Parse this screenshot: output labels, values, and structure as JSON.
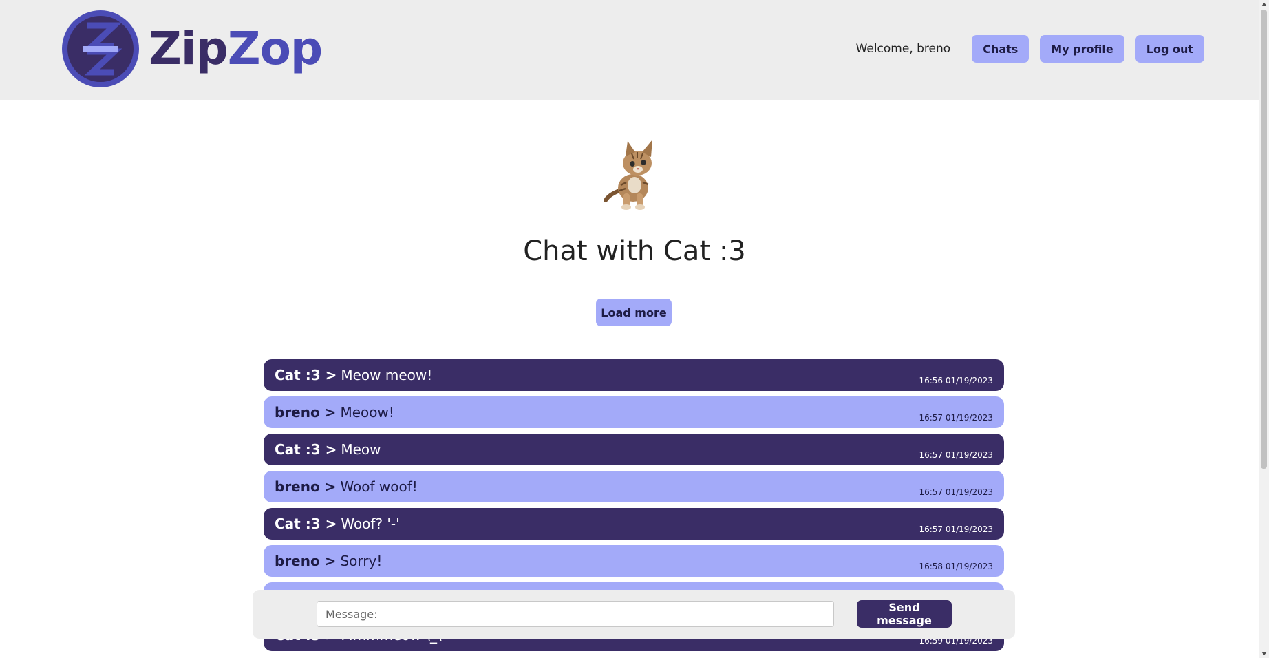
{
  "brand": {
    "part1": "Zip",
    "part2": "Zop"
  },
  "header": {
    "welcome": "Welcome, breno",
    "nav": {
      "chats": "Chats",
      "profile": "My profile",
      "logout": "Log out"
    }
  },
  "chat": {
    "title": "Chat with Cat :3",
    "load_more": "Load more",
    "messages": [
      {
        "author": "Cat :3 >",
        "text": "Meow meow!",
        "time": "16:56 01/19/2023",
        "kind": "other"
      },
      {
        "author": "breno >",
        "text": "Meoow!",
        "time": "16:57 01/19/2023",
        "kind": "mine"
      },
      {
        "author": "Cat :3 >",
        "text": "Meow",
        "time": "16:57 01/19/2023",
        "kind": "other"
      },
      {
        "author": "breno >",
        "text": "Woof woof!",
        "time": "16:57 01/19/2023",
        "kind": "mine"
      },
      {
        "author": "Cat :3 >",
        "text": "Woof? '-'",
        "time": "16:57 01/19/2023",
        "kind": "other"
      },
      {
        "author": "breno >",
        "text": "Sorry!",
        "time": "16:58 01/19/2023",
        "kind": "mine"
      },
      {
        "author": "",
        "text": "",
        "time": "",
        "kind": "mine"
      },
      {
        "author": "Cat :3 >",
        "text": "Mmmmeow \\_\\",
        "time": "16:59 01/19/2023",
        "kind": "other"
      }
    ]
  },
  "compose": {
    "placeholder": "Message:",
    "send": "Send message"
  },
  "colors": {
    "dark": "#3a2d66",
    "light": "#a3aaf9",
    "brand_blue": "#4b4cb6",
    "header_bg": "#ededed"
  }
}
